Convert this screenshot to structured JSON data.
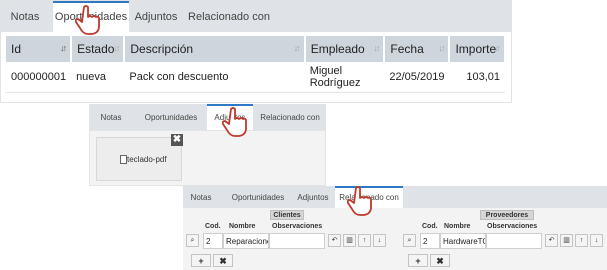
{
  "panel1": {
    "tabs": [
      "Notas",
      "Oportunidades",
      "Adjuntos",
      "Relacionado con"
    ],
    "active_tab": 1,
    "columns": [
      "Id",
      "Estado",
      "Descripción",
      "Empleado",
      "Fecha",
      "Importe"
    ],
    "rows": [
      {
        "id": "000000001",
        "estado": "nueva",
        "descripcion": "Pack con descuento",
        "empleado": "Miguel Rodríguez",
        "fecha": "22/05/2019",
        "importe": "103,01"
      }
    ]
  },
  "panel2": {
    "tabs": [
      "Notas",
      "Oportunidades",
      "Adjuntos",
      "Relacionado con"
    ],
    "active_tab": 2,
    "file_name": "teclado-pdf",
    "close_symbol": "✖"
  },
  "panel3": {
    "tabs": [
      "Notas",
      "Oportunidades",
      "Adjuntos",
      "Relacionado con"
    ],
    "active_tab": 3,
    "clientes": {
      "title": "Clientes",
      "columns": [
        "Cod.",
        "Nombre",
        "Observaciones"
      ],
      "row": {
        "cod": "2",
        "nombre": "Reparacione",
        "observaciones": ""
      }
    },
    "proveedores": {
      "title": "Proveedores",
      "columns": [
        "Cod.",
        "Nombre",
        "Observaciones"
      ],
      "row": {
        "cod": "2",
        "nombre": "HardwareTO",
        "observaciones": ""
      }
    },
    "add_symbol": "+",
    "remove_symbol": "✖"
  },
  "colors": {
    "tab_bar": "#dfe3e7",
    "accent": "#2f78c4",
    "header": "#cfd5dc",
    "cursor": "#c0392b"
  }
}
